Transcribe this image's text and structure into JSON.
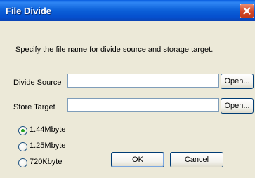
{
  "window": {
    "title": "File Divide",
    "close_icon": "close-icon"
  },
  "instruction": "Specify the file name for divide source and storage target.",
  "divide_source": {
    "label": "Divide Source",
    "value": "",
    "open_label": "Open..."
  },
  "store_target": {
    "label": "Store Target",
    "value": "",
    "open_label": "Open..."
  },
  "size_options": [
    {
      "label": "1.44Mbyte",
      "selected": true
    },
    {
      "label": "1.25Mbyte",
      "selected": false
    },
    {
      "label": "720Kbyte",
      "selected": false
    }
  ],
  "buttons": {
    "ok_label": "OK",
    "cancel_label": "Cancel"
  },
  "colors": {
    "titlebar": "#0b5fd8",
    "dialog_bg": "#ece9d8",
    "close_button": "#d54a2a",
    "radio_selected": "#21a121"
  }
}
